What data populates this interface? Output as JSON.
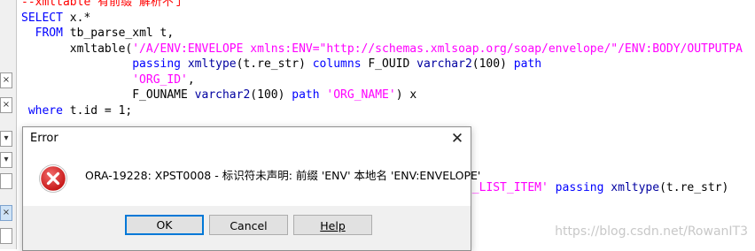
{
  "editor": {
    "lines": [
      {
        "parts": [
          {
            "t": "--xmltable 有前缀 解析不了",
            "c": "cm"
          }
        ]
      },
      {
        "parts": [
          {
            "t": "SELECT ",
            "c": "kw"
          },
          {
            "t": "x.*",
            "c": ""
          }
        ]
      },
      {
        "parts": [
          {
            "t": "  FROM ",
            "c": "kw"
          },
          {
            "t": "tb_parse_xml t,",
            "c": ""
          }
        ]
      },
      {
        "parts": [
          {
            "t": "       xmltable(",
            "c": ""
          },
          {
            "t": "'/A/ENV:ENVELOPE xmlns:ENV=\"http://schemas.xmlsoap.org/soap/envelope/\"/ENV:BODY/OUTPUTPA",
            "c": "st"
          }
        ]
      },
      {
        "parts": [
          {
            "t": "                passing ",
            "c": "kw"
          },
          {
            "t": "xmltype",
            "c": "ty"
          },
          {
            "t": "(t.re_str) ",
            "c": ""
          },
          {
            "t": "columns ",
            "c": "kw"
          },
          {
            "t": "F_OUID ",
            "c": ""
          },
          {
            "t": "varchar2",
            "c": "ty"
          },
          {
            "t": "(100) ",
            "c": ""
          },
          {
            "t": "path",
            "c": "kw"
          }
        ]
      },
      {
        "parts": [
          {
            "t": "                ",
            "c": ""
          },
          {
            "t": "'ORG_ID'",
            "c": "st"
          },
          {
            "t": ",",
            "c": ""
          }
        ]
      },
      {
        "parts": [
          {
            "t": "                F_OUNAME ",
            "c": ""
          },
          {
            "t": "varchar2",
            "c": "ty"
          },
          {
            "t": "(100) ",
            "c": ""
          },
          {
            "t": "path ",
            "c": "kw"
          },
          {
            "t": "'ORG_NAME'",
            "c": "st"
          },
          {
            "t": ") x",
            "c": ""
          }
        ]
      },
      {
        "parts": [
          {
            "t": " where ",
            "c": "kw"
          },
          {
            "t": "t.id = 1;",
            "c": ""
          }
        ]
      },
      {
        "parts": []
      },
      {
        "parts": []
      },
      {
        "parts": []
      },
      {
        "parts": []
      },
      {
        "parts": [
          {
            "t": "                                                               ",
            "c": ""
          },
          {
            "t": "RG_LIST_ITEM'",
            "c": "st"
          },
          {
            "t": " passing ",
            "c": "kw"
          },
          {
            "t": "xmltype",
            "c": "ty"
          },
          {
            "t": "(t.re_str)",
            "c": ""
          }
        ]
      }
    ]
  },
  "gutter": {
    "buttons": [
      "×",
      "×",
      "▾",
      "▾",
      "",
      "×",
      ""
    ]
  },
  "dialog": {
    "title": "Error",
    "close_label": "✕",
    "message": "ORA-19228: XPST0008 - 标识符未声明: 前缀 'ENV' 本地名 'ENV:ENVELOPE'",
    "ok_label": "OK",
    "cancel_label": "Cancel",
    "help_label": "Help"
  },
  "watermark": "https://blog.csdn.net/RowanIT3",
  "colors": {
    "keyword": "#0000ff",
    "string": "#ff00ff",
    "comment": "#ff0000",
    "type": "#0000a0",
    "error_red": "#d81e1e"
  }
}
